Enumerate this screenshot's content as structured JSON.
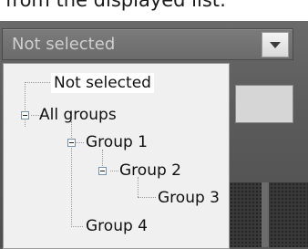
{
  "page": {
    "caption": "from the displayed list:"
  },
  "select": {
    "value": "Not selected",
    "toggle_icon": "chevron-down-icon"
  },
  "tree": {
    "items": [
      {
        "label": "Not selected",
        "level": 0,
        "selected": true
      },
      {
        "label": "All groups",
        "level": 0,
        "expanded": true
      },
      {
        "label": "Group 1",
        "level": 1,
        "expanded": true
      },
      {
        "label": "Group 2",
        "level": 2,
        "expanded": true
      },
      {
        "label": "Group 3",
        "level": 3
      },
      {
        "label": "Group 4",
        "level": 1
      }
    ]
  },
  "colors": {
    "panel_background": "#585858",
    "dropdown_background": "#f0f0f0",
    "selected_background": "#ffffff",
    "tree_lines": "#9a9a9a"
  }
}
